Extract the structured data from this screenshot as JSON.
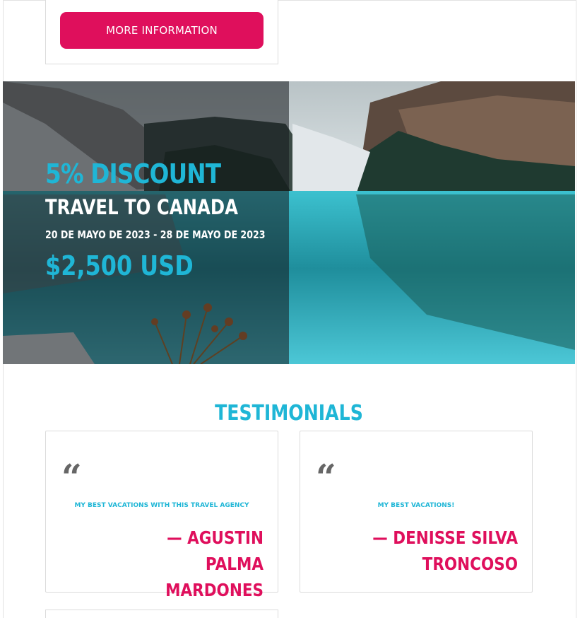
{
  "top_card": {
    "button_label": "MORE INFORMATION"
  },
  "promo": {
    "discount": "5% DISCOUNT",
    "destination": "TRAVEL TO CANADA",
    "dates": "20 DE MAYO DE 2023 - 28 DE MAYO DE 2023",
    "price": "$2,500 USD"
  },
  "testimonials": {
    "title": "TESTIMONIALS",
    "items": [
      {
        "quote": "MY BEST VACATIONS WITH THIS TRAVEL AGENCY",
        "author": "— AGUSTIN PALMA MARDONES"
      },
      {
        "quote": "MY BEST VACATIONS!",
        "author": "— DENISSE SILVA TRONCOSO"
      }
    ],
    "quote_icon": "quote-icon"
  },
  "colors": {
    "accent_pink": "#df0f5c",
    "accent_cyan": "#1fb6d6",
    "quote_gray": "#666666"
  }
}
